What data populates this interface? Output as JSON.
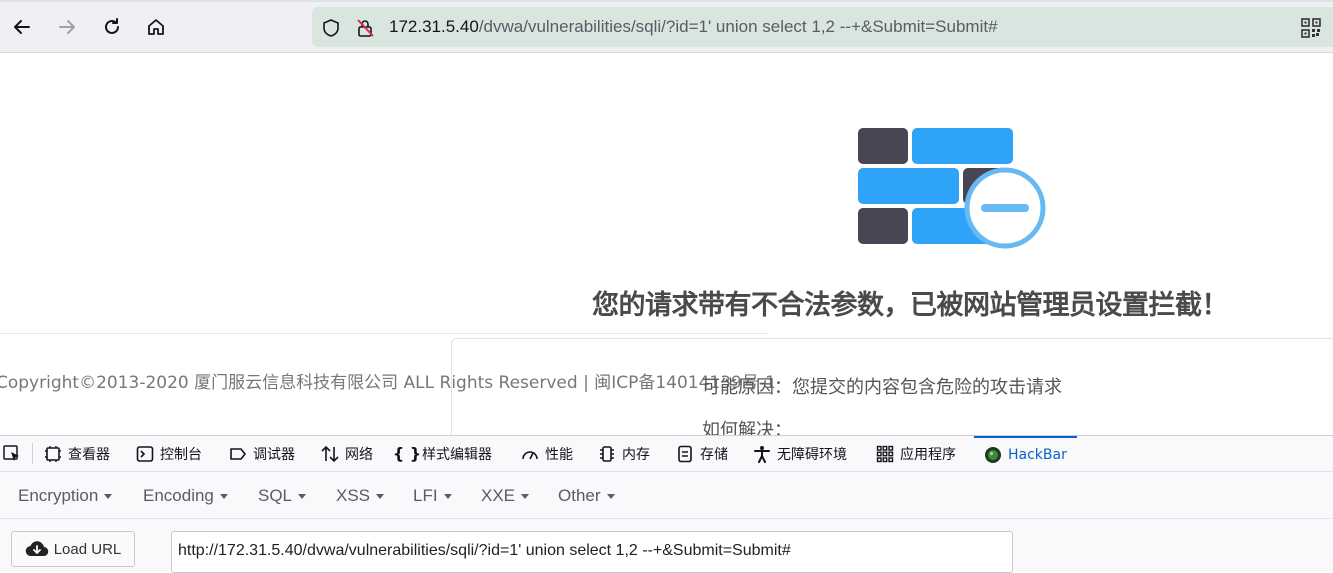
{
  "browser": {
    "url_host": "172.31.5.40",
    "url_path": "/dvwa/vulnerabilities/sqli/?id=1' union select 1,2 --+&Submit=Submit#"
  },
  "page": {
    "block_message": "您的请求带有不合法参数，已被网站管理员设置拦截！",
    "copyright": "Copyright©2013-2020 厦门服云信息科技有限公司 ALL Rights Reserved | 闽ICP备14014139号-1",
    "reason": "可能原因：您提交的内容包含危险的攻击请求",
    "howto": "如何解决：",
    "logo_colors": {
      "dark": "#484554",
      "blue": "#2ea3f7",
      "circle": "#67b9f4"
    }
  },
  "devtools": {
    "tabs": [
      {
        "label": "查看器",
        "icon": "inspector-icon"
      },
      {
        "label": "控制台",
        "icon": "console-icon"
      },
      {
        "label": "调试器",
        "icon": "debugger-icon"
      },
      {
        "label": "网络",
        "icon": "network-icon"
      },
      {
        "label": "样式编辑器",
        "icon": "style-editor-icon"
      },
      {
        "label": "性能",
        "icon": "performance-icon"
      },
      {
        "label": "内存",
        "icon": "memory-icon"
      },
      {
        "label": "存储",
        "icon": "storage-icon"
      },
      {
        "label": "无障碍环境",
        "icon": "accessibility-icon"
      },
      {
        "label": "应用程序",
        "icon": "application-icon"
      },
      {
        "label": "HackBar",
        "icon": "hackbar-icon"
      }
    ],
    "active_tab": "HackBar"
  },
  "hackbar": {
    "menu": [
      "Encryption",
      "Encoding",
      "SQL",
      "XSS",
      "LFI",
      "XXE",
      "Other"
    ],
    "load_url_label": "Load URL",
    "url_value": "http://172.31.5.40/dvwa/vulnerabilities/sqli/?id=1' union select 1,2 --+&Submit=Submit#"
  }
}
